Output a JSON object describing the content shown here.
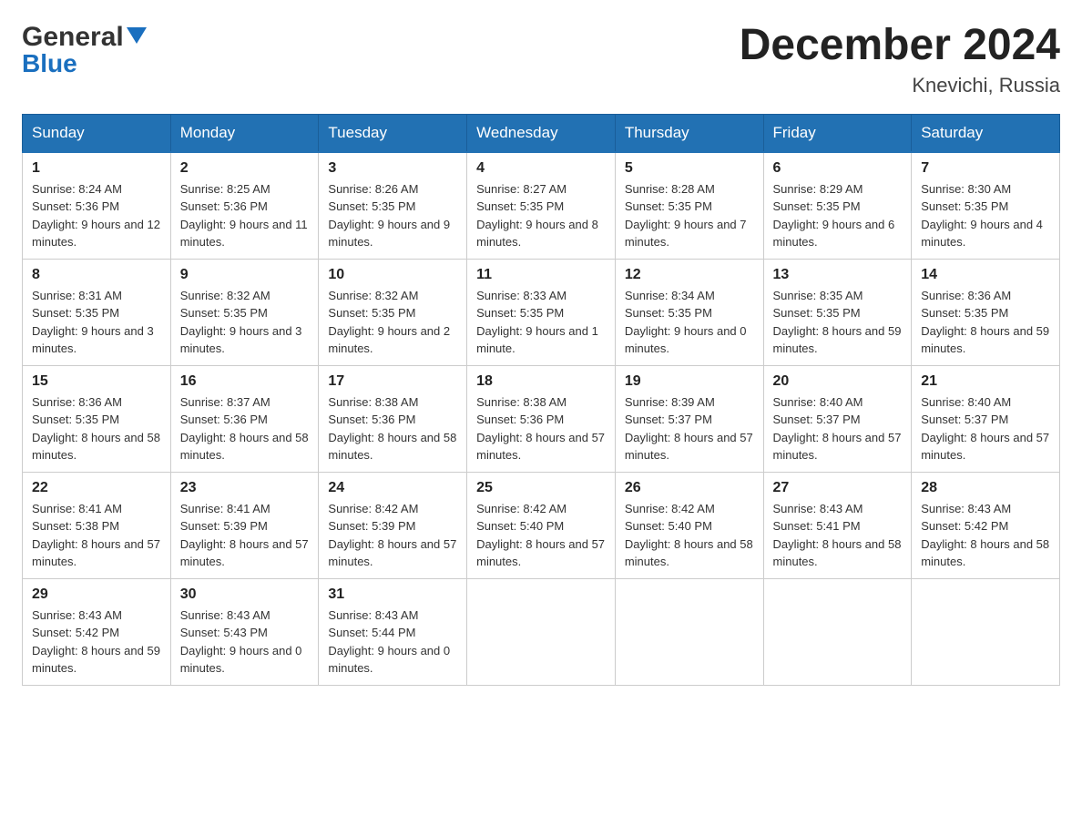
{
  "header": {
    "logo_general": "General",
    "logo_blue": "Blue",
    "title": "December 2024",
    "subtitle": "Knevichi, Russia"
  },
  "calendar": {
    "days_of_week": [
      "Sunday",
      "Monday",
      "Tuesday",
      "Wednesday",
      "Thursday",
      "Friday",
      "Saturday"
    ],
    "weeks": [
      [
        {
          "day": "1",
          "sunrise": "8:24 AM",
          "sunset": "5:36 PM",
          "daylight": "9 hours and 12 minutes."
        },
        {
          "day": "2",
          "sunrise": "8:25 AM",
          "sunset": "5:36 PM",
          "daylight": "9 hours and 11 minutes."
        },
        {
          "day": "3",
          "sunrise": "8:26 AM",
          "sunset": "5:35 PM",
          "daylight": "9 hours and 9 minutes."
        },
        {
          "day": "4",
          "sunrise": "8:27 AM",
          "sunset": "5:35 PM",
          "daylight": "9 hours and 8 minutes."
        },
        {
          "day": "5",
          "sunrise": "8:28 AM",
          "sunset": "5:35 PM",
          "daylight": "9 hours and 7 minutes."
        },
        {
          "day": "6",
          "sunrise": "8:29 AM",
          "sunset": "5:35 PM",
          "daylight": "9 hours and 6 minutes."
        },
        {
          "day": "7",
          "sunrise": "8:30 AM",
          "sunset": "5:35 PM",
          "daylight": "9 hours and 4 minutes."
        }
      ],
      [
        {
          "day": "8",
          "sunrise": "8:31 AM",
          "sunset": "5:35 PM",
          "daylight": "9 hours and 3 minutes."
        },
        {
          "day": "9",
          "sunrise": "8:32 AM",
          "sunset": "5:35 PM",
          "daylight": "9 hours and 3 minutes."
        },
        {
          "day": "10",
          "sunrise": "8:32 AM",
          "sunset": "5:35 PM",
          "daylight": "9 hours and 2 minutes."
        },
        {
          "day": "11",
          "sunrise": "8:33 AM",
          "sunset": "5:35 PM",
          "daylight": "9 hours and 1 minute."
        },
        {
          "day": "12",
          "sunrise": "8:34 AM",
          "sunset": "5:35 PM",
          "daylight": "9 hours and 0 minutes."
        },
        {
          "day": "13",
          "sunrise": "8:35 AM",
          "sunset": "5:35 PM",
          "daylight": "8 hours and 59 minutes."
        },
        {
          "day": "14",
          "sunrise": "8:36 AM",
          "sunset": "5:35 PM",
          "daylight": "8 hours and 59 minutes."
        }
      ],
      [
        {
          "day": "15",
          "sunrise": "8:36 AM",
          "sunset": "5:35 PM",
          "daylight": "8 hours and 58 minutes."
        },
        {
          "day": "16",
          "sunrise": "8:37 AM",
          "sunset": "5:36 PM",
          "daylight": "8 hours and 58 minutes."
        },
        {
          "day": "17",
          "sunrise": "8:38 AM",
          "sunset": "5:36 PM",
          "daylight": "8 hours and 58 minutes."
        },
        {
          "day": "18",
          "sunrise": "8:38 AM",
          "sunset": "5:36 PM",
          "daylight": "8 hours and 57 minutes."
        },
        {
          "day": "19",
          "sunrise": "8:39 AM",
          "sunset": "5:37 PM",
          "daylight": "8 hours and 57 minutes."
        },
        {
          "day": "20",
          "sunrise": "8:40 AM",
          "sunset": "5:37 PM",
          "daylight": "8 hours and 57 minutes."
        },
        {
          "day": "21",
          "sunrise": "8:40 AM",
          "sunset": "5:37 PM",
          "daylight": "8 hours and 57 minutes."
        }
      ],
      [
        {
          "day": "22",
          "sunrise": "8:41 AM",
          "sunset": "5:38 PM",
          "daylight": "8 hours and 57 minutes."
        },
        {
          "day": "23",
          "sunrise": "8:41 AM",
          "sunset": "5:39 PM",
          "daylight": "8 hours and 57 minutes."
        },
        {
          "day": "24",
          "sunrise": "8:42 AM",
          "sunset": "5:39 PM",
          "daylight": "8 hours and 57 minutes."
        },
        {
          "day": "25",
          "sunrise": "8:42 AM",
          "sunset": "5:40 PM",
          "daylight": "8 hours and 57 minutes."
        },
        {
          "day": "26",
          "sunrise": "8:42 AM",
          "sunset": "5:40 PM",
          "daylight": "8 hours and 58 minutes."
        },
        {
          "day": "27",
          "sunrise": "8:43 AM",
          "sunset": "5:41 PM",
          "daylight": "8 hours and 58 minutes."
        },
        {
          "day": "28",
          "sunrise": "8:43 AM",
          "sunset": "5:42 PM",
          "daylight": "8 hours and 58 minutes."
        }
      ],
      [
        {
          "day": "29",
          "sunrise": "8:43 AM",
          "sunset": "5:42 PM",
          "daylight": "8 hours and 59 minutes."
        },
        {
          "day": "30",
          "sunrise": "8:43 AM",
          "sunset": "5:43 PM",
          "daylight": "9 hours and 0 minutes."
        },
        {
          "day": "31",
          "sunrise": "8:43 AM",
          "sunset": "5:44 PM",
          "daylight": "9 hours and 0 minutes."
        },
        null,
        null,
        null,
        null
      ]
    ],
    "labels": {
      "sunrise": "Sunrise:",
      "sunset": "Sunset:",
      "daylight": "Daylight:"
    }
  }
}
